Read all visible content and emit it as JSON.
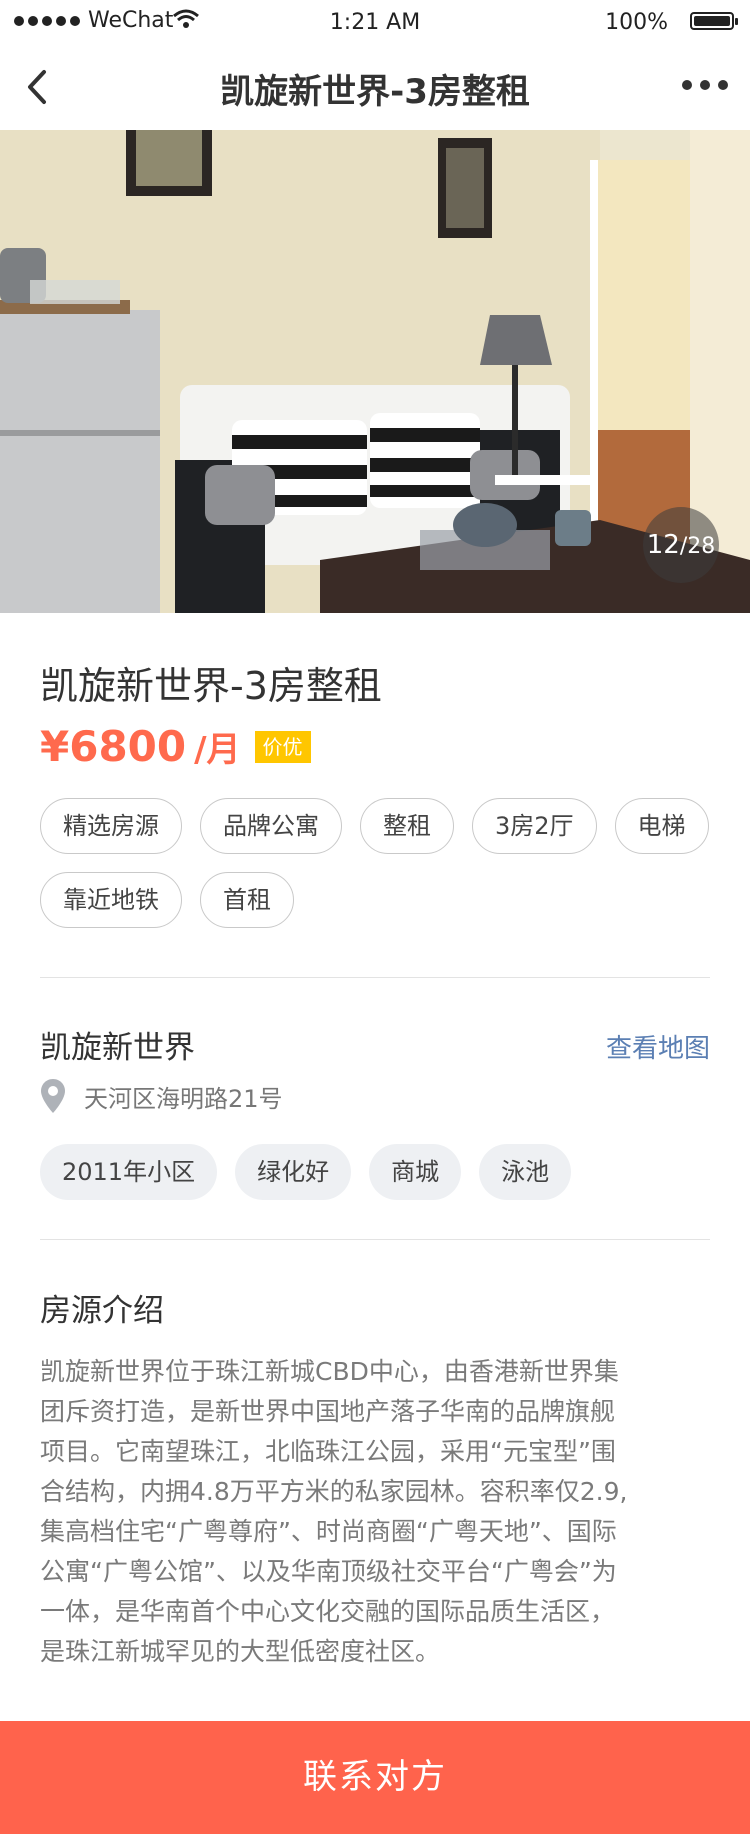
{
  "status_bar": {
    "carrier": "WeChat",
    "time": "1:21 AM",
    "battery": "100%"
  },
  "nav": {
    "title": "凯旋新世界-3房整租"
  },
  "gallery": {
    "current": "12",
    "total": "/28"
  },
  "listing": {
    "title": "凯旋新世界-3房整租",
    "price": "¥6800",
    "unit": "/月",
    "badge": "价优",
    "tags": [
      "精选房源",
      "品牌公寓",
      "整租",
      "3房2厅",
      "电梯",
      "靠近地铁",
      "首租"
    ]
  },
  "community": {
    "name": "凯旋新世界",
    "map_link": "查看地图",
    "address": "天河区海明路21号",
    "tags": [
      "2011年小区",
      "绿化好",
      "商城",
      "泳池"
    ]
  },
  "description": {
    "title": "房源介绍",
    "lines": [
      "凯旋新世界位于珠江新城CBD中心，由香港新世界集",
      "团斥资打造，是新世界中国地产落子华南的品牌旗舰",
      "项目。它南望珠江，北临珠江公园，采用“元宝型”围",
      "合结构，内拥4.8万平方米的私家园林。容积率仅2.9,",
      "集高档住宅“广粤尊府”、时尚商圈“广粤天地”、国际",
      "公寓“广粤公馆”、以及华南顶级社交平台“广粤会”为",
      "一体，是华南首个中心文化交融的国际品质生活区，",
      "是珠江新城罕见的大型低密度社区。"
    ]
  },
  "cta": {
    "label": "联系对方"
  },
  "colors": {
    "accent": "#ff634c",
    "price": "#ff6a4d",
    "badge": "#ffc600",
    "link": "#5b7fb3"
  }
}
